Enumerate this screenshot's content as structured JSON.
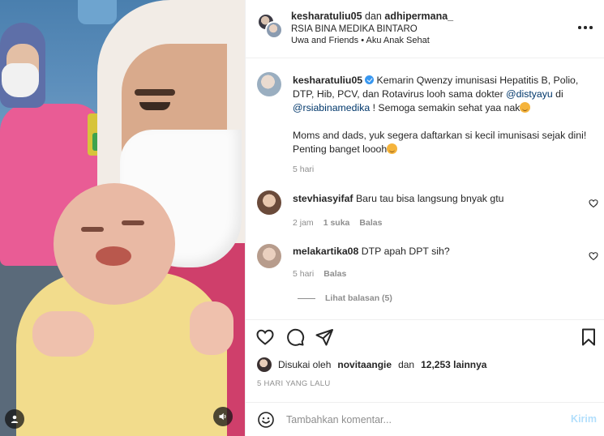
{
  "header": {
    "user1": "kesharatuliu05",
    "joiner": "dan",
    "user2": "adhipermana_",
    "location": "RSIA BINA MEDIKA BINTARO",
    "audio": "Uwa and Friends • Aku Anak Sehat"
  },
  "caption": {
    "username": "kesharatuliu05",
    "text1": "Kemarin Qwenzy imunisasi Hepatitis B, Polio, DTP, Hib, PCV, dan Rotavirus looh sama dokter ",
    "mention1": "@distyayu",
    "text2": " di ",
    "mention2": "@rsiabinamedika",
    "text3": " ! Semoga semakin sehat yaa nak",
    "text4": "Moms and dads, yuk segera daftarkan si kecil imunisasi sejak dini! Penting banget loooh",
    "time": "5 hari"
  },
  "comments": [
    {
      "username": "stevhiasyifaf",
      "text": "Baru tau bisa langsung bnyak gtu",
      "time": "2 jam",
      "likes": "1 suka",
      "reply": "Balas"
    },
    {
      "username": "melakartika08",
      "text": "DTP apah DPT sih?",
      "time": "5 hari",
      "reply": "Balas",
      "view_replies": "Lihat balasan (5)"
    }
  ],
  "likes": {
    "prefix": "Disukai oleh",
    "user": "novitaangie",
    "joiner": "dan",
    "count": "12,253 lainnya"
  },
  "timestamp": "5 HARI YANG LALU",
  "add_comment": {
    "placeholder": "Tambahkan komentar...",
    "post_label": "Kirim"
  },
  "colors": {
    "link": "#00376b",
    "muted": "#8e8e8e",
    "post_disabled": "#b2dffc",
    "verified": "#3897f0"
  }
}
